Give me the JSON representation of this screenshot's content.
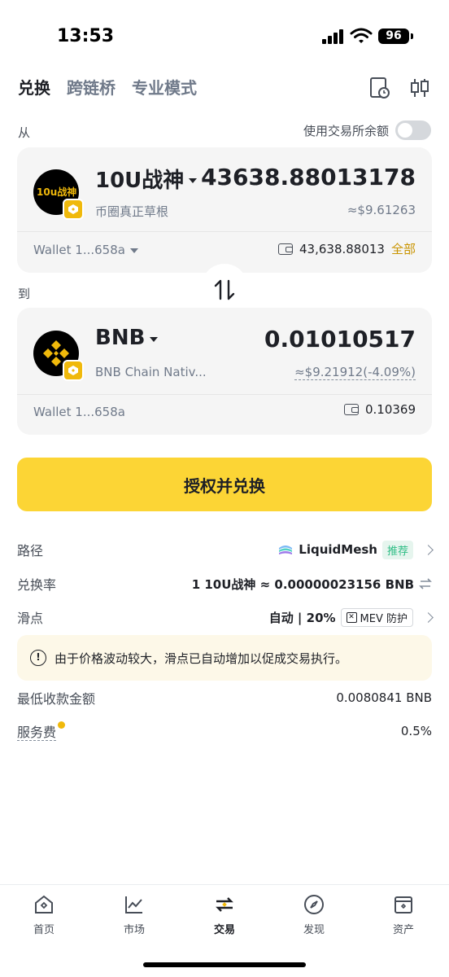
{
  "status_bar": {
    "time": "13:53",
    "battery": "96"
  },
  "tabs": [
    {
      "label": "兑换",
      "active": true
    },
    {
      "label": "跨链桥",
      "active": false
    },
    {
      "label": "专业模式",
      "active": false
    }
  ],
  "from": {
    "label": "从",
    "use_balance_label": "使用交易所余额",
    "token_symbol": "10U战神",
    "token_logo_text": "10u战神",
    "token_subtitle": "币圈真正草根",
    "amount": "43638.88013178",
    "usd_value": "≈$9.61263",
    "wallet": "Wallet 1...658a",
    "balance": "43,638.88013",
    "max_label": "全部"
  },
  "to": {
    "label": "到",
    "token_symbol": "BNB",
    "token_subtitle": "BNB Chain Nativ...",
    "amount": "0.01010517",
    "usd_value": "≈$9.21912(-4.09%)",
    "wallet": "Wallet 1...658a",
    "balance": "0.10369"
  },
  "primary_button": "授权并兑换",
  "details": {
    "route_label": "路径",
    "route_value": "LiquidMesh",
    "route_tag": "推荐",
    "rate_label": "兑换率",
    "rate_value": "1 10U战神 ≈ 0.00000023156 BNB",
    "slippage_label": "滑点",
    "slippage_value": "自动 | 20%",
    "mev_label": "MEV 防护",
    "notice": "由于价格波动较大，滑点已自动增加以促成交易执行。",
    "min_receive_label": "最低收款金额",
    "min_receive_value": "0.0080841 BNB",
    "fee_label": "服务费",
    "fee_value": "0.5%"
  },
  "bottom_nav": [
    {
      "label": "首页",
      "icon": "home-icon",
      "active": false
    },
    {
      "label": "市场",
      "icon": "market-chart-icon",
      "active": false
    },
    {
      "label": "交易",
      "icon": "trade-swap-icon",
      "active": true
    },
    {
      "label": "发现",
      "icon": "discover-compass-icon",
      "active": false
    },
    {
      "label": "资产",
      "icon": "assets-wallet-icon",
      "active": false
    }
  ],
  "colors": {
    "accent": "#fcd535",
    "brand": "#f0b90b",
    "positive": "#2ebd85"
  }
}
